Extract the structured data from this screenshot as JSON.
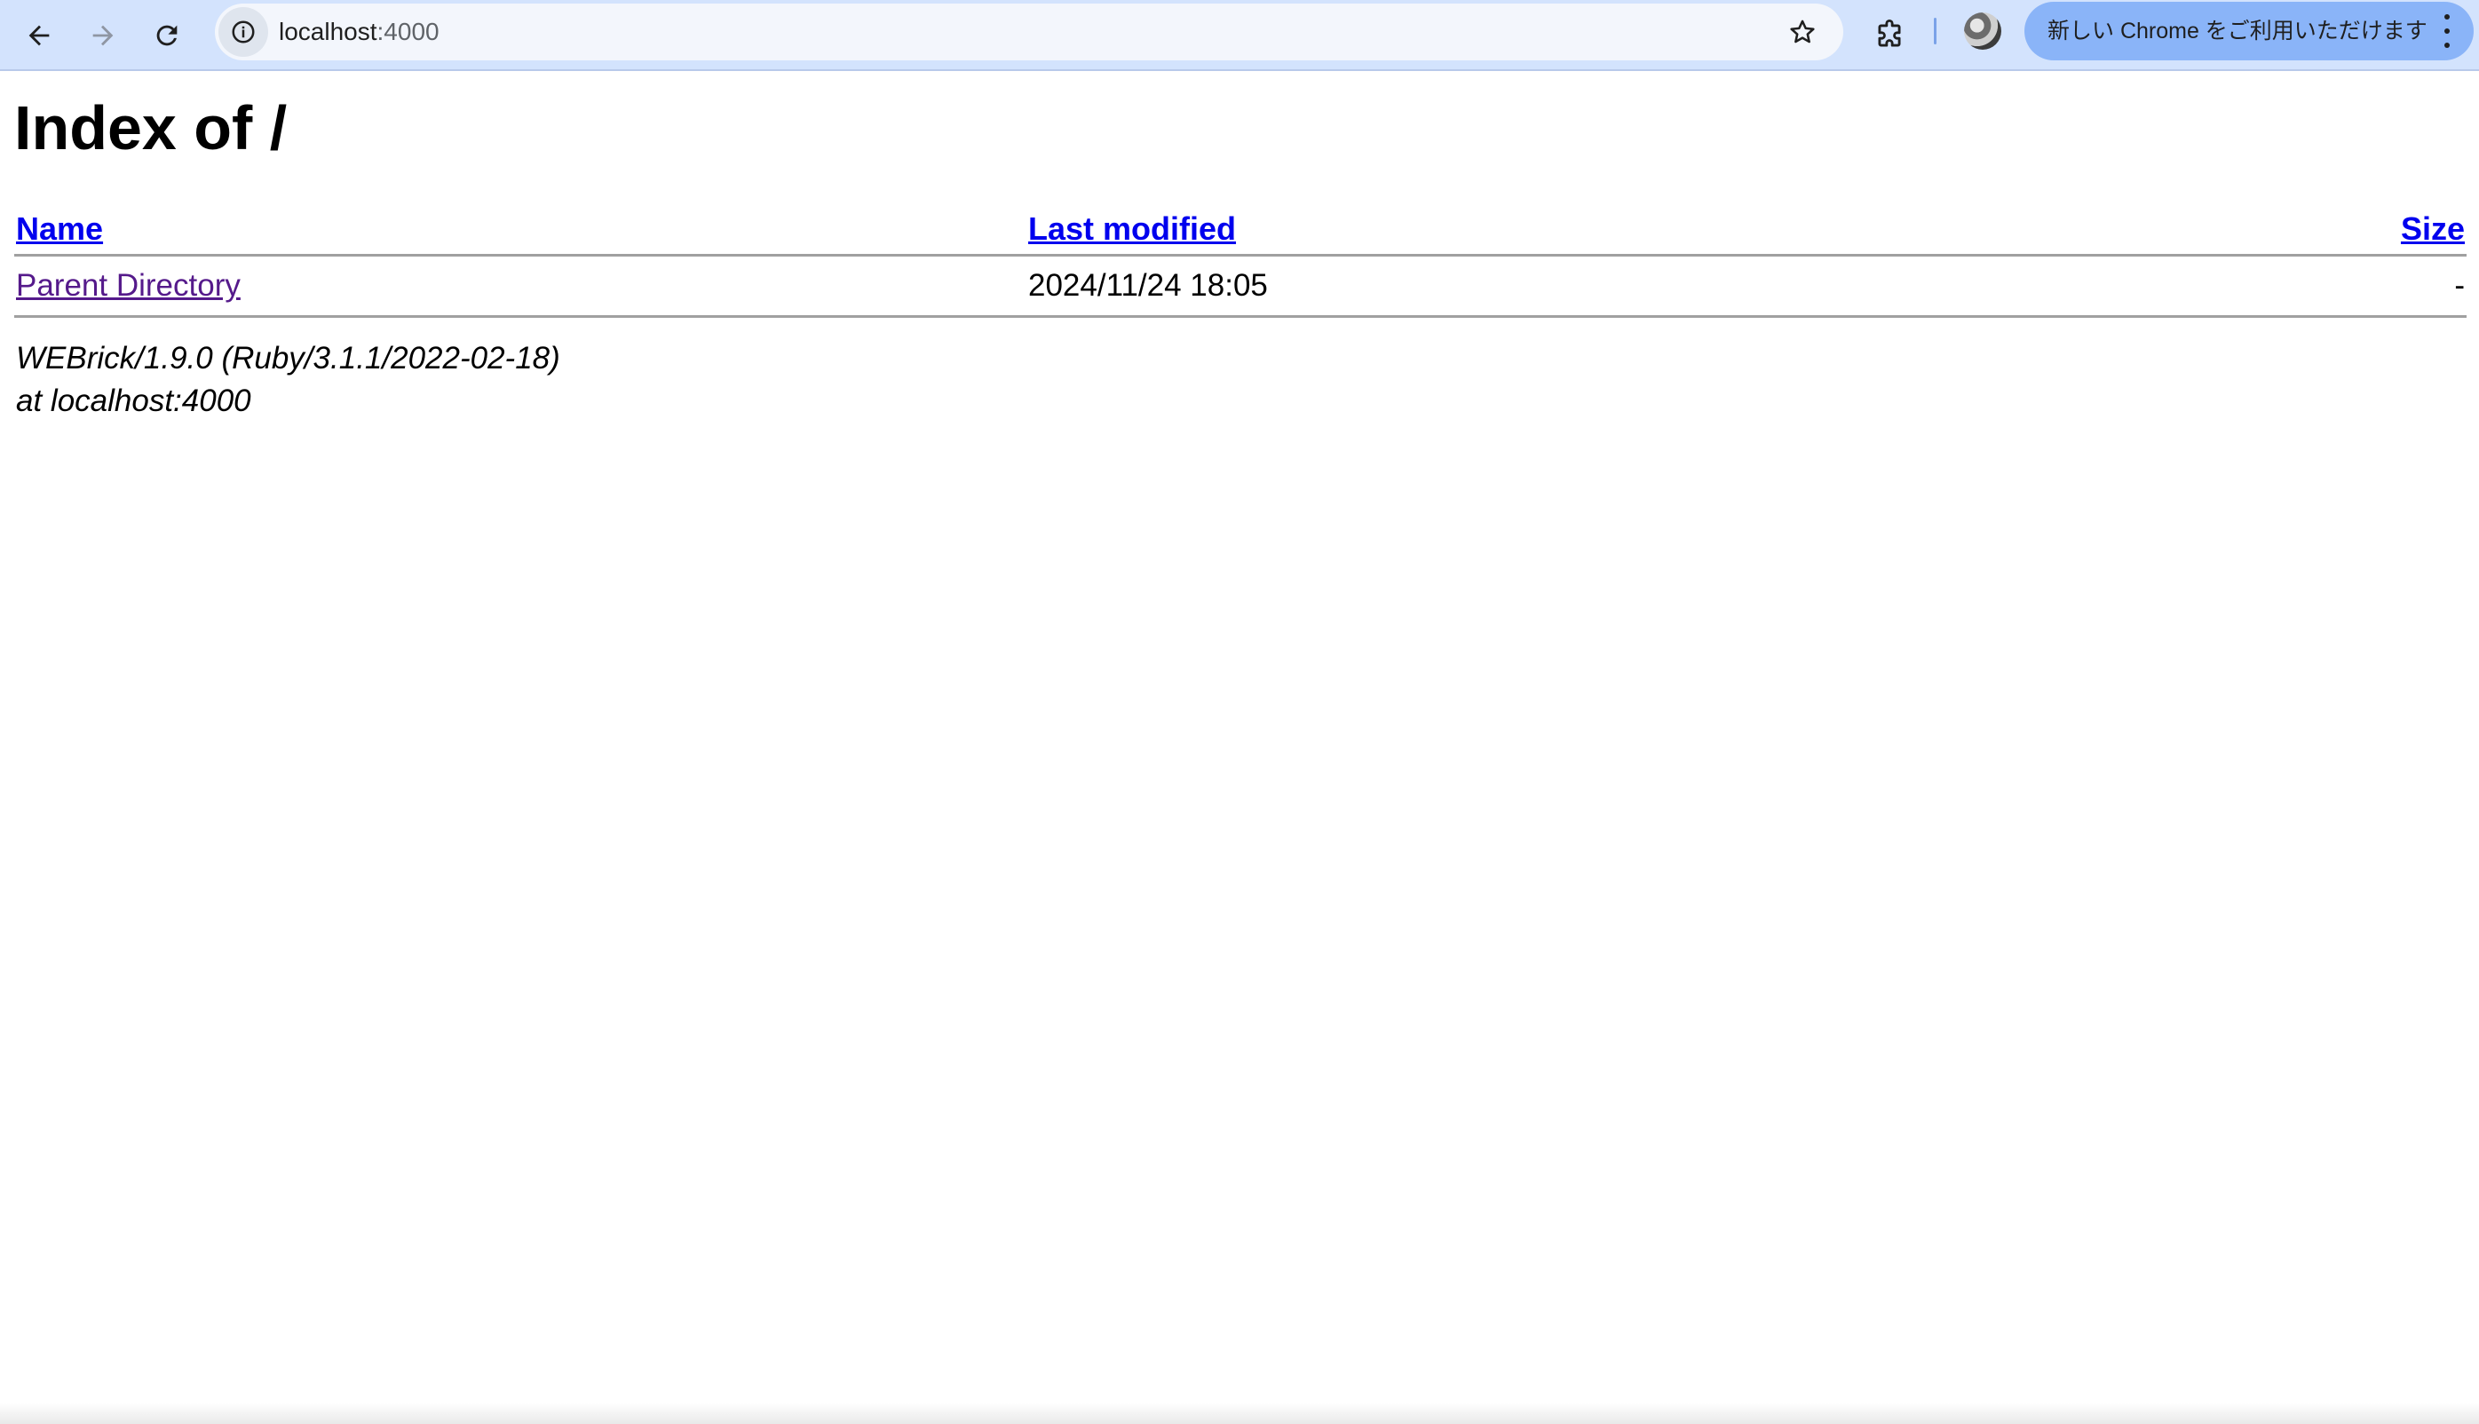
{
  "browser": {
    "url_host": "localhost",
    "url_port": ":4000",
    "update_button_label": "新しい Chrome をご利用いただけます",
    "icons": [
      "back-arrow-icon",
      "forward-arrow-icon",
      "reload-icon",
      "info-icon",
      "star-icon",
      "extensions-puzzle-icon",
      "profile-avatar",
      "more-vert-icon"
    ]
  },
  "page": {
    "title": "Index of /",
    "columns": {
      "name": "Name",
      "last_modified": "Last modified",
      "size": "Size"
    },
    "entries": [
      {
        "name": "Parent Directory",
        "last_modified": "2024/11/24 18:05",
        "size": "-"
      }
    ],
    "footer": {
      "server": "WEBrick/1.9.0 (Ruby/3.1.1/2022-02-18)",
      "host": "at localhost:4000"
    }
  },
  "colors": {
    "toolbar_bg": "#d3e3fd",
    "omnibox_bg": "#f3f6fc",
    "update_chip_bg": "#8ab4f8",
    "link_unvisited": "#0000ee",
    "link_visited": "#551a8b"
  }
}
